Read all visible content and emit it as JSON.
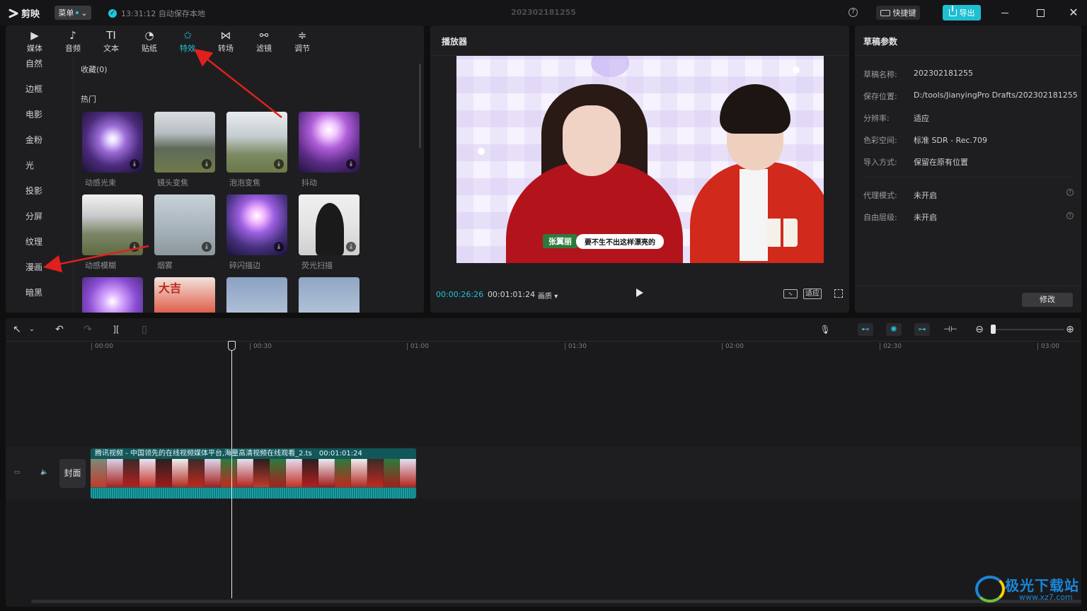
{
  "titlebar": {
    "app_name": "剪映",
    "menu_label": "菜单",
    "autosave_text": "13:31:12 自动保存本地",
    "project_title": "202302181255",
    "help_glyph": "?",
    "shortcut_label": "快捷键",
    "export_label": "导出",
    "close_glyph": "✕"
  },
  "toolbar": {
    "tabs": [
      {
        "label": "媒体",
        "icon": "media-icon",
        "glyph": "▶"
      },
      {
        "label": "音频",
        "icon": "audio-icon",
        "glyph": "♪"
      },
      {
        "label": "文本",
        "icon": "text-icon",
        "glyph": "TI"
      },
      {
        "label": "贴纸",
        "icon": "sticker-icon",
        "glyph": "◔"
      },
      {
        "label": "特效",
        "icon": "effects-icon",
        "glyph": "✩"
      },
      {
        "label": "转场",
        "icon": "transition-icon",
        "glyph": "⋈"
      },
      {
        "label": "滤镜",
        "icon": "filter-icon",
        "glyph": "⚯"
      },
      {
        "label": "调节",
        "icon": "adjust-icon",
        "glyph": "≑"
      }
    ],
    "active_tab": "特效"
  },
  "effects_sidebar": {
    "items": [
      "自然",
      "边框",
      "电影",
      "金粉",
      "光",
      "投影",
      "分屏",
      "纹理",
      "漫画",
      "暗黑"
    ]
  },
  "effects_content": {
    "favorites_label": "收藏(0)",
    "hot_label": "热门",
    "download_glyph": "⤓",
    "cards": [
      {
        "label": "动感光束"
      },
      {
        "label": "镜头变焦"
      },
      {
        "label": "泡泡变焦"
      },
      {
        "label": "抖动"
      },
      {
        "label": "动感模糊"
      },
      {
        "label": "烟雾"
      },
      {
        "label": "碎闪描边"
      },
      {
        "label": "荧光扫描"
      },
      {
        "label": ""
      },
      {
        "label": ""
      },
      {
        "label": ""
      },
      {
        "label": ""
      }
    ],
    "card3_text": "大吉"
  },
  "player": {
    "title": "播放器",
    "caption_name": "张翼丽",
    "caption_text": "要不生不出这样漂亮的",
    "current_time": "00:00:26:26",
    "total_time": "00:01:01:24",
    "quality_label": "画质",
    "fit_label": "适应",
    "wave_glyph": "∿"
  },
  "draft": {
    "title": "草稿参数",
    "params": [
      {
        "key": "草稿名称:",
        "value": "202302181255"
      },
      {
        "key": "保存位置:",
        "value": "D:/tools/JianyingPro Drafts/202302181255"
      },
      {
        "key": "分辨率:",
        "value": "适应"
      },
      {
        "key": "色彩空间:",
        "value": "标准 SDR - Rec.709"
      },
      {
        "key": "导入方式:",
        "value": "保留在原有位置"
      },
      {
        "key": "代理模式:",
        "value": "未开启"
      },
      {
        "key": "自由层级:",
        "value": "未开启"
      }
    ],
    "info_glyph": "?",
    "modify_label": "修改"
  },
  "timeline": {
    "toolbar_glyphs": {
      "select": "↖",
      "undo": "↶",
      "redo": "↷",
      "split": "][",
      "delete": "▯",
      "mic": "🎙",
      "magnet": "⊷",
      "link": "✺",
      "preview": "⊶",
      "align": "⊣⊢",
      "zoom_out": "⊖",
      "zoom_in": "⊕"
    },
    "ruler": [
      "00:00",
      "00:30",
      "01:00",
      "01:30",
      "02:00",
      "02:30",
      "03:00"
    ],
    "cover_label": "封面",
    "clip_title": "腾讯视频 - 中国领先的在线视频媒体平台,海量高清视频在线观看_2.ts",
    "clip_duration": "00:01:01:24"
  },
  "watermark": {
    "text": "极光下载站",
    "url": "www.xz7.com"
  }
}
